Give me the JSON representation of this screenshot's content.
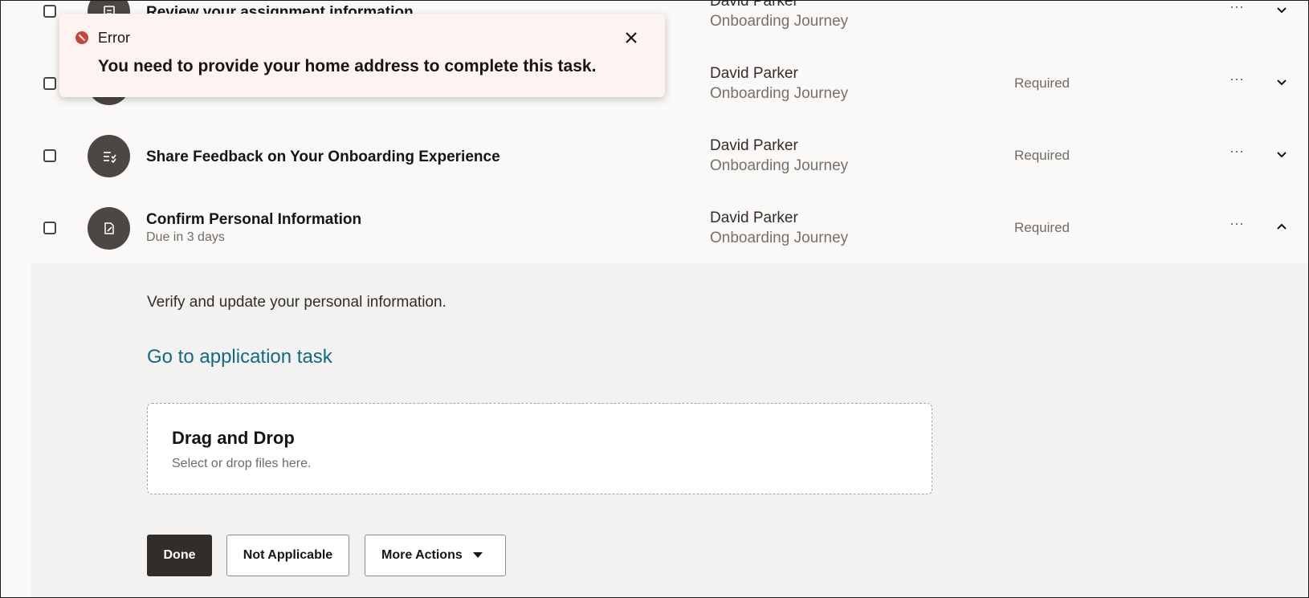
{
  "toast": {
    "label": "Error",
    "message": "You need to provide your home address to complete this task."
  },
  "tasks": [
    {
      "title": "Review your assignment information",
      "person": "David Parker",
      "journey": "Onboarding Journey",
      "status": "",
      "icon": "form-icon"
    },
    {
      "title": "",
      "person": "David Parker",
      "journey": "Onboarding Journey",
      "status": "Required",
      "icon": "task-icon"
    },
    {
      "title": "Share Feedback on Your Onboarding Experience",
      "person": "David Parker",
      "journey": "Onboarding Journey",
      "status": "Required",
      "icon": "checklist-icon"
    },
    {
      "title": "Confirm Personal Information",
      "due": "Due in 3 days",
      "person": "David Parker",
      "journey": "Onboarding Journey",
      "status": "Required",
      "icon": "edit-document-icon"
    }
  ],
  "more_glyph": "⋯",
  "detail": {
    "description": "Verify and update your personal information.",
    "link": "Go to application task",
    "dropzone": {
      "title": "Drag and Drop",
      "hint": "Select or drop files here."
    },
    "buttons": {
      "done": "Done",
      "not_applicable": "Not Applicable",
      "more_actions": "More Actions"
    }
  },
  "colors": {
    "error": "#c74634",
    "link": "#0f6a86",
    "primary_button": "#312d2a"
  }
}
